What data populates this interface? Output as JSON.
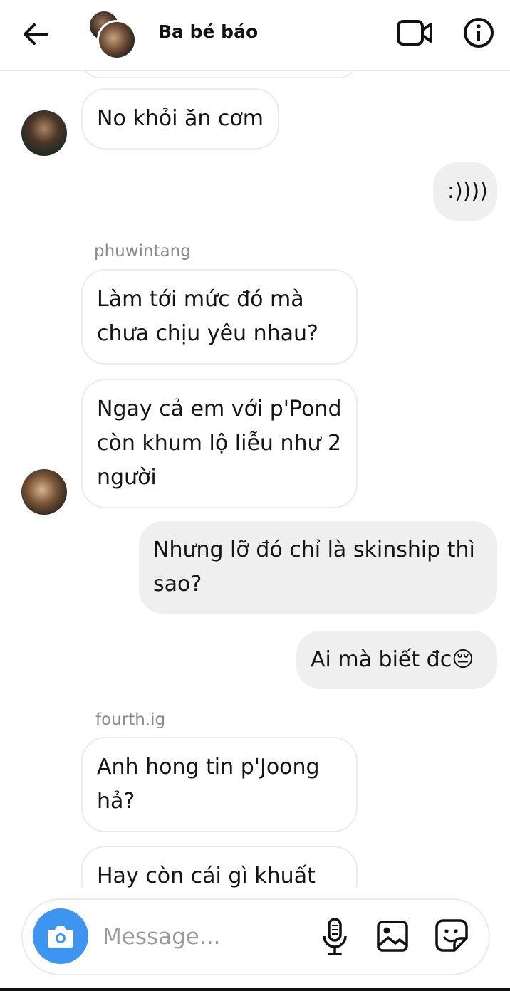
{
  "header": {
    "title": "Ba bé báo",
    "icons": [
      "back-arrow-icon",
      "video-call-icon",
      "info-icon"
    ]
  },
  "messages": [
    {
      "side": "in",
      "text": "No khỏi ăn cơm"
    },
    {
      "side": "out",
      "text": ":))))"
    },
    {
      "side": "in",
      "sender": "phuwintang",
      "text": "Làm tới mức đó mà chưa chịu yêu nhau?"
    },
    {
      "side": "in",
      "text": "Ngay cả em với p'Pond còn khum lộ liễu như 2 người"
    },
    {
      "side": "out",
      "text": "Nhưng lỡ đó chỉ là skinship thì sao?"
    },
    {
      "side": "out",
      "text": "Ai mà biết đc😔"
    },
    {
      "side": "in",
      "sender": "fourth.ig",
      "text": "Anh hong tin p'Joong hả?"
    },
    {
      "side": "in",
      "text": "Hay còn cái gì khuất"
    }
  ],
  "composer": {
    "placeholder": "Message...",
    "accent_color": "#3d95ef",
    "icons": [
      "camera-icon",
      "microphone-icon",
      "gallery-icon",
      "sticker-icon"
    ]
  }
}
